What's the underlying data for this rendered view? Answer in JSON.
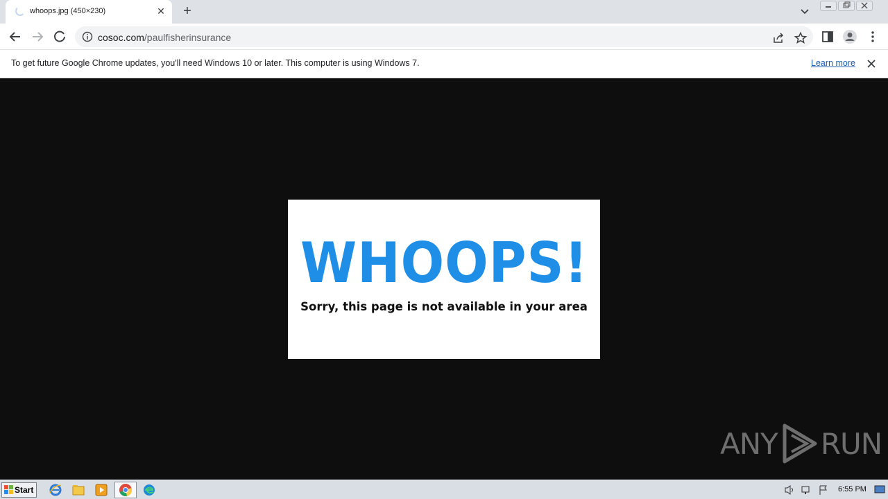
{
  "browser": {
    "tab": {
      "title": "whoops.jpg (450×230)",
      "close_glyph": "✕"
    },
    "new_tab_glyph": "+",
    "address": {
      "host": "cosoc.com",
      "path": "/paulfisherinsurance"
    },
    "infobar": {
      "message": "To get future Google Chrome updates, you'll need Windows 10 or later. This computer is using Windows 7.",
      "link": "Learn more"
    }
  },
  "content": {
    "headline": "WHOOPS!",
    "subtext": "Sorry, this page is not available in your area",
    "headline_color": "#1e8ee6"
  },
  "watermark": {
    "text_left": "ANY",
    "text_right": "RUN"
  },
  "taskbar": {
    "start_label": "Start",
    "clock": "6:55 PM",
    "pinned": [
      "internet-explorer-icon",
      "file-explorer-icon",
      "media-player-icon",
      "chrome-icon",
      "edge-icon"
    ]
  }
}
